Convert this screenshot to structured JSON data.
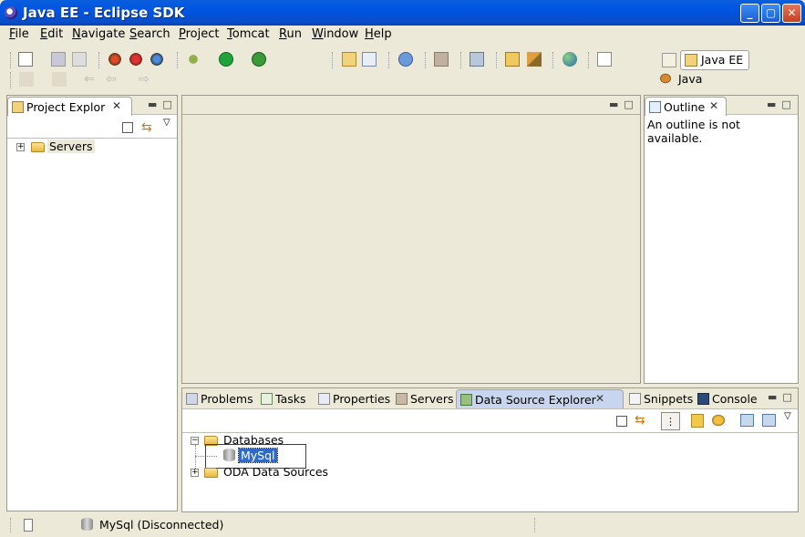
{
  "window": {
    "title": "Java EE - Eclipse SDK"
  },
  "menu": [
    "File",
    "Edit",
    "Navigate",
    "Search",
    "Project",
    "Tomcat",
    "Run",
    "Window",
    "Help"
  ],
  "perspectives": {
    "active": "Java EE",
    "other": "Java"
  },
  "project_explorer": {
    "tab_label": "Project Explor",
    "items": [
      {
        "label": "Servers"
      }
    ]
  },
  "outline": {
    "tab_label": "Outline",
    "message": "An outline is not available."
  },
  "bottom_tabs": [
    {
      "label": "Problems"
    },
    {
      "label": "Tasks"
    },
    {
      "label": "Properties"
    },
    {
      "label": "Servers"
    },
    {
      "label": "Data Source Explorer"
    },
    {
      "label": "Snippets"
    },
    {
      "label": "Console"
    }
  ],
  "data_source_explorer": {
    "databases_label": "Databases",
    "connection_label": "MySql",
    "oda_label": "ODA Data Sources"
  },
  "status": {
    "text": "MySql (Disconnected)"
  },
  "colors": {
    "titlebar": "#0054e3",
    "highlight": "#316ac5",
    "callout_border": "#d00000"
  }
}
